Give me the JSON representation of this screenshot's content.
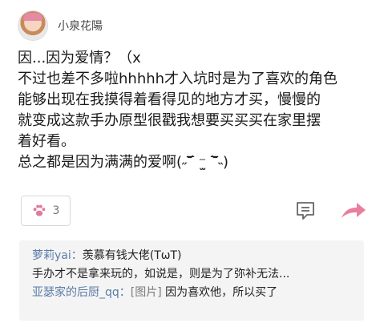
{
  "post": {
    "username": "小泉花陽",
    "content_lines": [
      "因...因为爱情？（x",
      "不过也差不多啦hhhhh才入坑时是为了喜欢的角色",
      "能够出现在我摸得着看得见的地方才买，慢慢的",
      "就变成这款手办原型很戳我想要买买买在家里摆",
      "着好看。",
      "总之都是因为满满的爱啊(˶‾᷄ ⁻̫ ‾᷅˵)"
    ]
  },
  "actions": {
    "like_count": "3",
    "paw_color": "#e07ba0",
    "share_color": "#e8809d"
  },
  "replies": [
    {
      "user": "萝莉yai：",
      "text": "羡慕有钱大佬(TωT)"
    },
    {
      "user": "",
      "text": "手办才不是拿来玩的，如说是，则是为了弥补无法..."
    },
    {
      "user": "亚瑟家的后厨_qq：",
      "tag": "[图片]",
      "text": " 因为喜欢他，所以买了"
    }
  ]
}
